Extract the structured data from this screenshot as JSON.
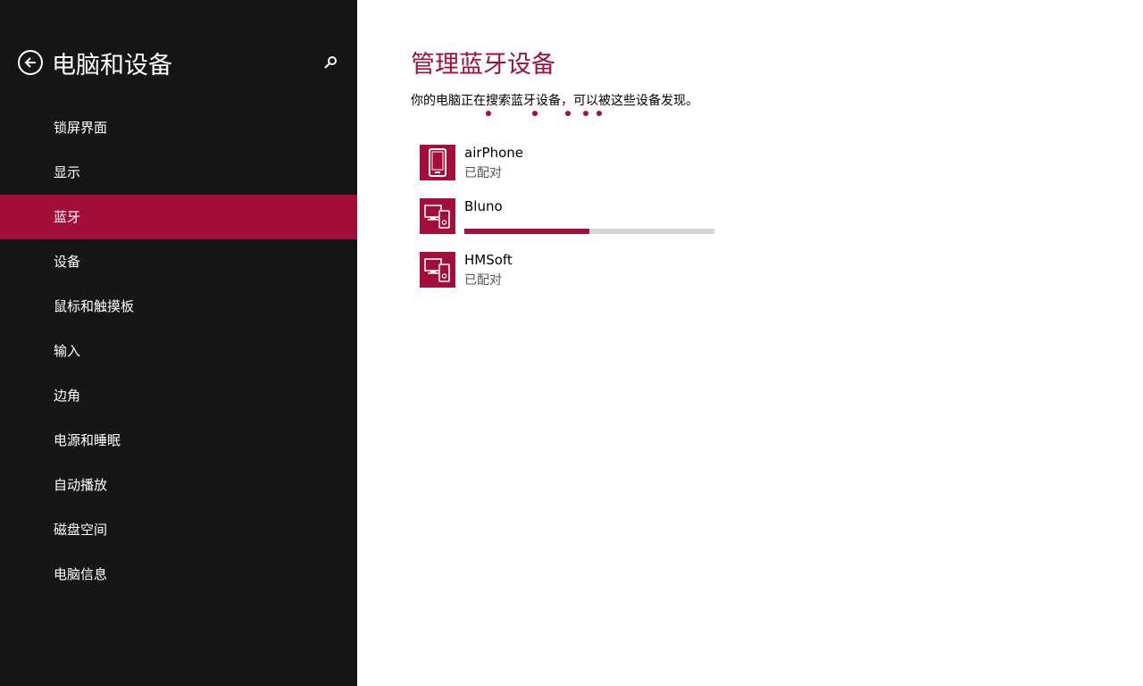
{
  "sidebar": {
    "title": "电脑和设备",
    "back_icon": "back-arrow-icon",
    "search_icon": "search-icon",
    "items": [
      {
        "label": "锁屏界面",
        "active": false
      },
      {
        "label": "显示",
        "active": false
      },
      {
        "label": "蓝牙",
        "active": true
      },
      {
        "label": "设备",
        "active": false
      },
      {
        "label": "鼠标和触摸板",
        "active": false
      },
      {
        "label": "输入",
        "active": false
      },
      {
        "label": "边角",
        "active": false
      },
      {
        "label": "电源和睡眠",
        "active": false
      },
      {
        "label": "自动播放",
        "active": false
      },
      {
        "label": "磁盘空间",
        "active": false
      },
      {
        "label": "电脑信息",
        "active": false
      }
    ]
  },
  "main": {
    "title": "管理蓝牙设备",
    "description": "你的电脑正在搜索蓝牙设备，可以被这些设备发现。",
    "devices": [
      {
        "name": "airPhone",
        "status": "已配对",
        "icon": "phone-icon"
      },
      {
        "name": "Bluno",
        "progress": 0.5,
        "icon": "devices-icon"
      },
      {
        "name": "HMSoft",
        "status": "已配对",
        "icon": "devices-icon"
      }
    ]
  },
  "colors": {
    "accent": "#a30e3b",
    "sidebar_bg": "#161616",
    "progress_track": "#d6d6d6"
  }
}
